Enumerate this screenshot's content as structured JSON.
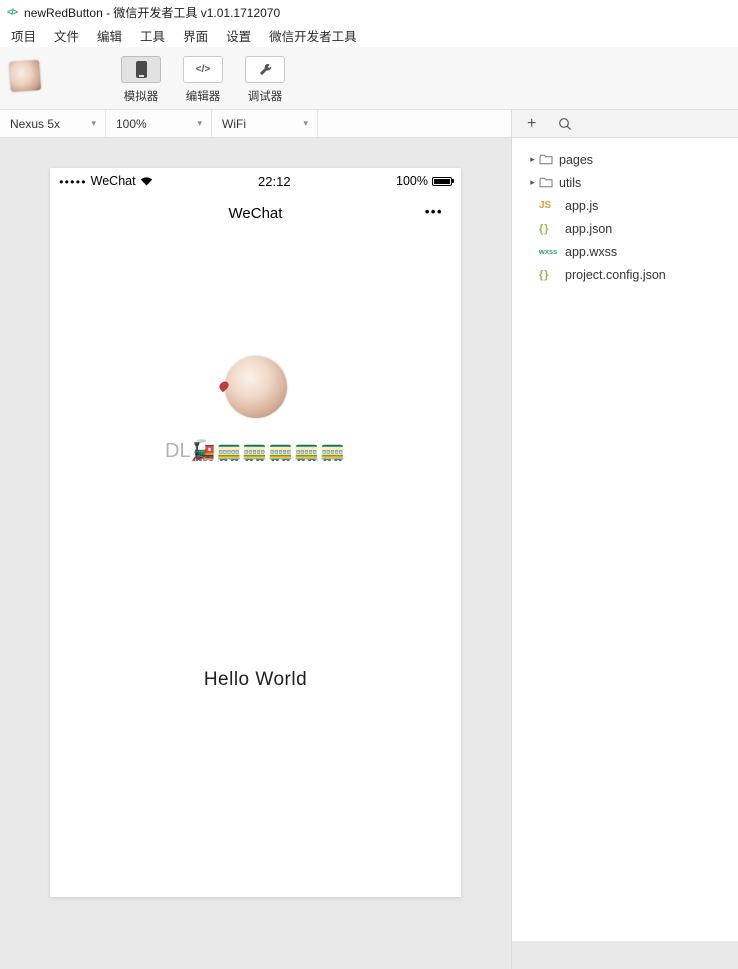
{
  "window": {
    "title": "newRedButton - 微信开发者工具 v1.01.1712070",
    "logo_glyph": "</>"
  },
  "menu": {
    "items": [
      "项目",
      "文件",
      "编辑",
      "工具",
      "界面",
      "设置",
      "微信开发者工具"
    ]
  },
  "toolbar": {
    "buttons": [
      {
        "label": "模拟器",
        "active": true
      },
      {
        "label": "编辑器",
        "active": false,
        "icon_glyph": "</>"
      },
      {
        "label": "调试器",
        "active": false
      }
    ]
  },
  "devicebar": {
    "device": "Nexus 5x",
    "zoom": "100%",
    "network": "WiFi",
    "chevron": "▾"
  },
  "panel_header": {
    "add_label": "+"
  },
  "simulator": {
    "statusbar": {
      "signal_dots": "●●●●●",
      "carrier": "WeChat",
      "time": "22:12",
      "battery": "100%"
    },
    "navbar": {
      "title": "WeChat",
      "more": "•••"
    },
    "content": {
      "train_label": "DL",
      "train_emojis": "🚂🚃🚃🚃🚃🚃",
      "greeting": "Hello World"
    }
  },
  "filetree": {
    "items": [
      {
        "type": "folder",
        "name": "pages",
        "arrow": "▸"
      },
      {
        "type": "folder",
        "name": "utils",
        "arrow": "▸"
      },
      {
        "type": "file",
        "badge": "JS",
        "name": "app.js"
      },
      {
        "type": "file",
        "badge": "{}",
        "name": "app.json"
      },
      {
        "type": "file",
        "badge": "wxss",
        "name": "app.wxss"
      },
      {
        "type": "file",
        "badge": "{}",
        "name": "project.config.json"
      }
    ]
  },
  "colors": {
    "js_badge": "#eba03c",
    "json_badge": "#8bbf4a",
    "wxss_badge": "#2f9e86",
    "toolbar_bg": "#f7f7f7",
    "sim_pane_bg": "#e9e9e9"
  }
}
